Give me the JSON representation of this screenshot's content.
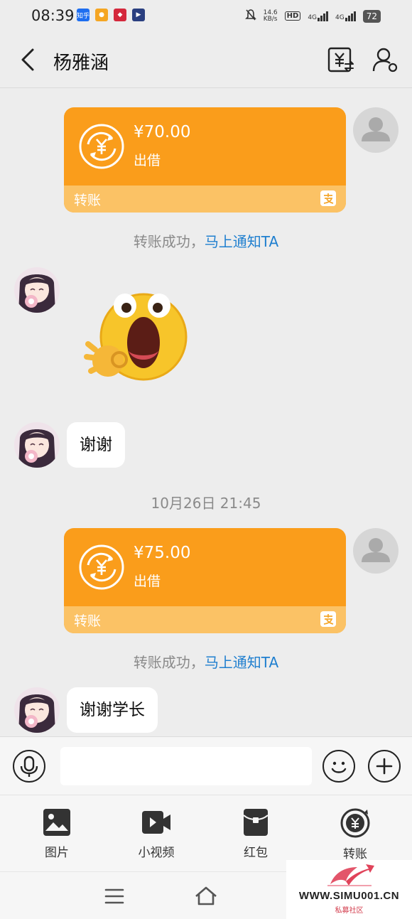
{
  "status_bar": {
    "time": "08:39",
    "apps": [
      {
        "icon": "zhihu-app-icon",
        "text": "知乎",
        "color": "#1e6ef0"
      },
      {
        "icon": "weibo-app-icon",
        "text": "",
        "color": "#f5a623"
      },
      {
        "icon": "app-icon-red",
        "text": "",
        "color": "#d4283c"
      },
      {
        "icon": "app-icon-blue",
        "text": "",
        "color": "#2a3f80"
      }
    ],
    "net_speed_value": "14.6",
    "net_speed_unit": "KB/s",
    "hd_label": "HD",
    "hd_sub": "1 2",
    "network_1": "4G",
    "network_2": "4G",
    "battery": "72"
  },
  "header": {
    "title": "杨雅涵",
    "back_icon": "chevron-left-icon",
    "transfer_icon": "yuan-transfer-icon",
    "profile_icon": "user-settings-icon"
  },
  "messages": {
    "transfer_1": {
      "amount": "¥70.00",
      "type": "出借",
      "label": "转账"
    },
    "note_1": {
      "text": "转账成功，",
      "link": "马上通知TA"
    },
    "reply_1": "谢谢",
    "timestamp": "10月26日 21:45",
    "transfer_2": {
      "amount": "¥75.00",
      "type": "出借",
      "label": "转账"
    },
    "note_2": {
      "text": "转账成功，",
      "link": "马上通知TA"
    },
    "reply_2": "谢谢学长"
  },
  "input": {
    "placeholder": "",
    "voice_icon": "microphone-icon",
    "emoji_icon": "smile-icon",
    "more_icon": "plus-icon"
  },
  "actions": [
    {
      "label": "图片",
      "icon": "image-icon"
    },
    {
      "label": "小视频",
      "icon": "video-icon"
    },
    {
      "label": "红包",
      "icon": "red-packet-icon"
    },
    {
      "label": "转账",
      "icon": "transfer-icon"
    }
  ],
  "navbar": {
    "menu_icon": "menu-icon",
    "home_icon": "home-icon"
  },
  "watermark": {
    "url": "WWW.SIMU001.CN",
    "subtitle": "私募社区"
  },
  "colors": {
    "transfer_orange": "#fa9d1b",
    "transfer_bottom": "#fbc265",
    "link_blue": "#1f7fcf",
    "background": "#ededed"
  }
}
